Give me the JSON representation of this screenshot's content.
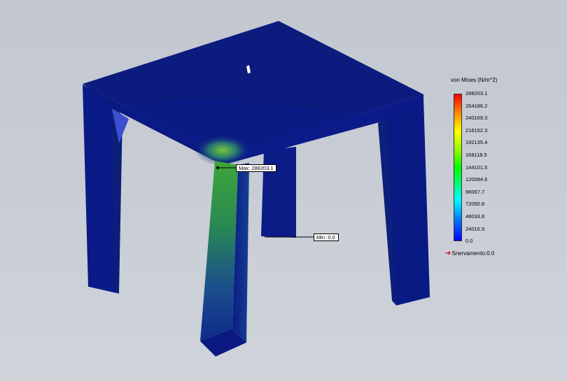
{
  "legend": {
    "title": "von Mises (N/m^2)",
    "ticks": [
      "288203.1",
      "264186.2",
      "240169.3",
      "216152.3",
      "192135.4",
      "168118.5",
      "144101.5",
      "120084.6",
      "96067.7",
      "72050.8",
      "48033.8",
      "24016.9",
      "0.0"
    ],
    "yield_label": "Snervamento:0.0"
  },
  "probes": {
    "max": "Max: 288203.1",
    "min": "Min: 0.0"
  },
  "colors": {
    "background": "#c7ccd4",
    "model_blue": "#0a1a82",
    "stress_green": "#2e9a3a"
  }
}
